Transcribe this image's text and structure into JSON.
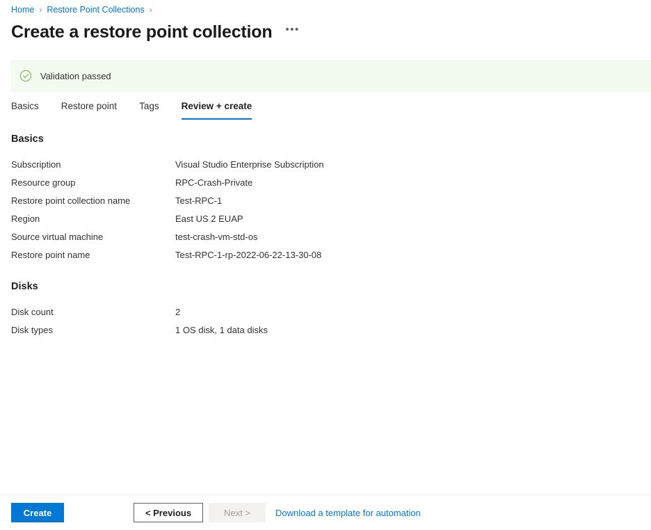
{
  "breadcrumb": {
    "items": [
      {
        "label": "Home"
      },
      {
        "label": "Restore Point Collections"
      }
    ],
    "separator": "›"
  },
  "header": {
    "title": "Create a restore point collection",
    "more_label": "•••"
  },
  "banner": {
    "icon": "check-circle-icon",
    "text": "Validation passed",
    "background": "#f3faef",
    "icon_color": "#7ab547"
  },
  "tabs": [
    {
      "label": "Basics",
      "active": false
    },
    {
      "label": "Restore point",
      "active": false
    },
    {
      "label": "Tags",
      "active": false
    },
    {
      "label": "Review + create",
      "active": true
    }
  ],
  "sections": [
    {
      "heading": "Basics",
      "rows": [
        {
          "key": "Subscription",
          "value": "Visual Studio Enterprise Subscription"
        },
        {
          "key": "Resource group",
          "value": "RPC-Crash-Private"
        },
        {
          "key": "Restore point collection name",
          "value": "Test-RPC-1"
        },
        {
          "key": "Region",
          "value": "East US 2 EUAP"
        },
        {
          "key": "Source virtual machine",
          "value": "test-crash-vm-std-os"
        },
        {
          "key": "Restore point name",
          "value": "Test-RPC-1-rp-2022-06-22-13-30-08"
        }
      ]
    },
    {
      "heading": "Disks",
      "rows": [
        {
          "key": "Disk count",
          "value": "2"
        },
        {
          "key": "Disk types",
          "value": "1 OS disk, 1 data disks"
        }
      ]
    }
  ],
  "footer": {
    "create_label": "Create",
    "previous_label": "< Previous",
    "next_label": "Next >",
    "download_link_label": "Download a template for automation"
  },
  "colors": {
    "accent": "#0078d4",
    "success": "#7ab547",
    "banner_bg": "#f3faef",
    "text": "#323130"
  }
}
